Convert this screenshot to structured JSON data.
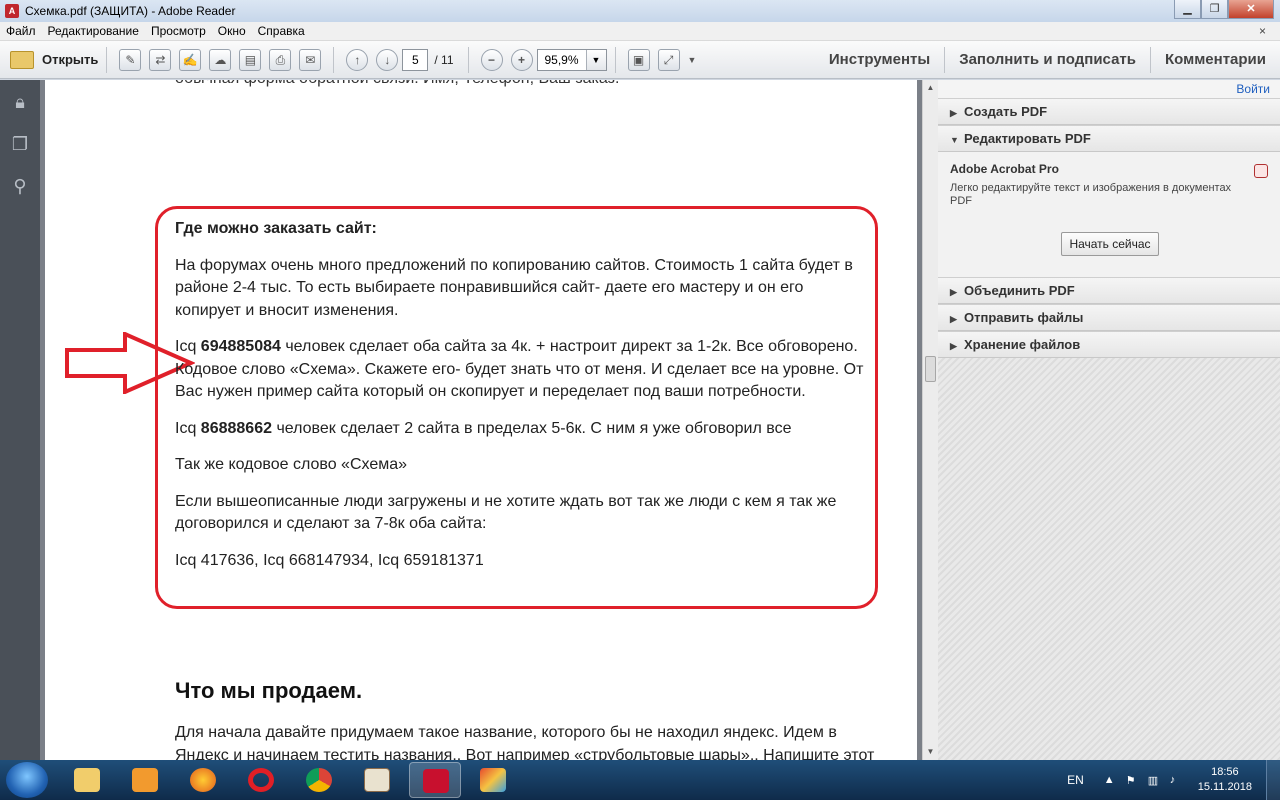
{
  "window": {
    "title": "Схемка.pdf (ЗАЩИТА) - Adobe Reader",
    "app_icon": "pdf-icon",
    "controls": [
      "minimize",
      "maximize",
      "close"
    ]
  },
  "menu": {
    "items": [
      "Файл",
      "Редактирование",
      "Просмотр",
      "Окно",
      "Справка"
    ],
    "close_glyph": "×"
  },
  "toolbar": {
    "open_label": "Открыть",
    "page_current": "5",
    "page_total": "/ 11",
    "zoom": "95,9%",
    "tools_label": "Инструменты",
    "fill_sign_label": "Заполнить и подписать",
    "comments_label": "Комментарии"
  },
  "document": {
    "cut_line": "обычная форма обратной связи. Имя, Телефон, Ваш заказ.",
    "box_heading": "Где можно заказать сайт:",
    "para1": "На форумах очень много предложений по копированию сайтов. Стоимость 1 сайта будет в районе 2-4 тыс. То есть выбираете понравившийся сайт- даете его мастеру и он его копирует и вносит изменения.",
    "para2_prefix": "Icq",
    "para2_number": "694885084",
    "para2_text": "человек сделает оба сайта за 4к. + настроит директ за 1-2к. Все обговорено. Кодовое слово «Схема». Скажете его- будет знать что от меня. И сделает все на уровне. От Вас нужен пример сайта который он скопирует и переделает под ваши потребности.",
    "para3_prefix": "Icq",
    "para3_number": "86888662",
    "para3_text": "человек сделает 2 сайта в пределах 5-6к. С ним я уже обговорил все",
    "para4": "Так же кодовое слово «Схема»",
    "para5": "Если вышеописанные люди загружены и не хотите ждать вот так же люди с кем я так же договорился и сделают за 7-8к оба сайта:",
    "para6": "Icq 417636, Icq 668147934, Icq 659181371",
    "section_title": "Что мы продаем.",
    "lower_para": "Для начала давайте придумаем такое название, которого бы не находил яндекс. Идем в Яндекс и начинаем тестить названия.. Вот например «струбольтовые шары».. Напишите этот запрос в Яндексе.. Он ничего не выдаст. Так что включаем свою фантазию)",
    "highlight_color": "#e0202a"
  },
  "right_panel": {
    "signin": "Войти",
    "sections": [
      {
        "label": "Создать PDF",
        "expanded": false
      },
      {
        "label": "Редактировать PDF",
        "expanded": true
      },
      {
        "label": "Объединить PDF",
        "expanded": false
      },
      {
        "label": "Отправить файлы",
        "expanded": false
      },
      {
        "label": "Хранение файлов",
        "expanded": false
      }
    ],
    "product_name": "Adobe Acrobat Pro",
    "product_desc": "Легко редактируйте текст и изображения в документах PDF",
    "start_button": "Начать сейчас"
  },
  "taskbar": {
    "apps": [
      "explorer-icon",
      "media-player-icon",
      "firefox-icon",
      "opera-icon",
      "chrome-icon",
      "mahjong-icon",
      "adobe-reader-icon",
      "paint-icon"
    ],
    "active_app": "adobe-reader-icon",
    "lang": "EN",
    "time": "18:56",
    "date": "15.11.2018"
  }
}
